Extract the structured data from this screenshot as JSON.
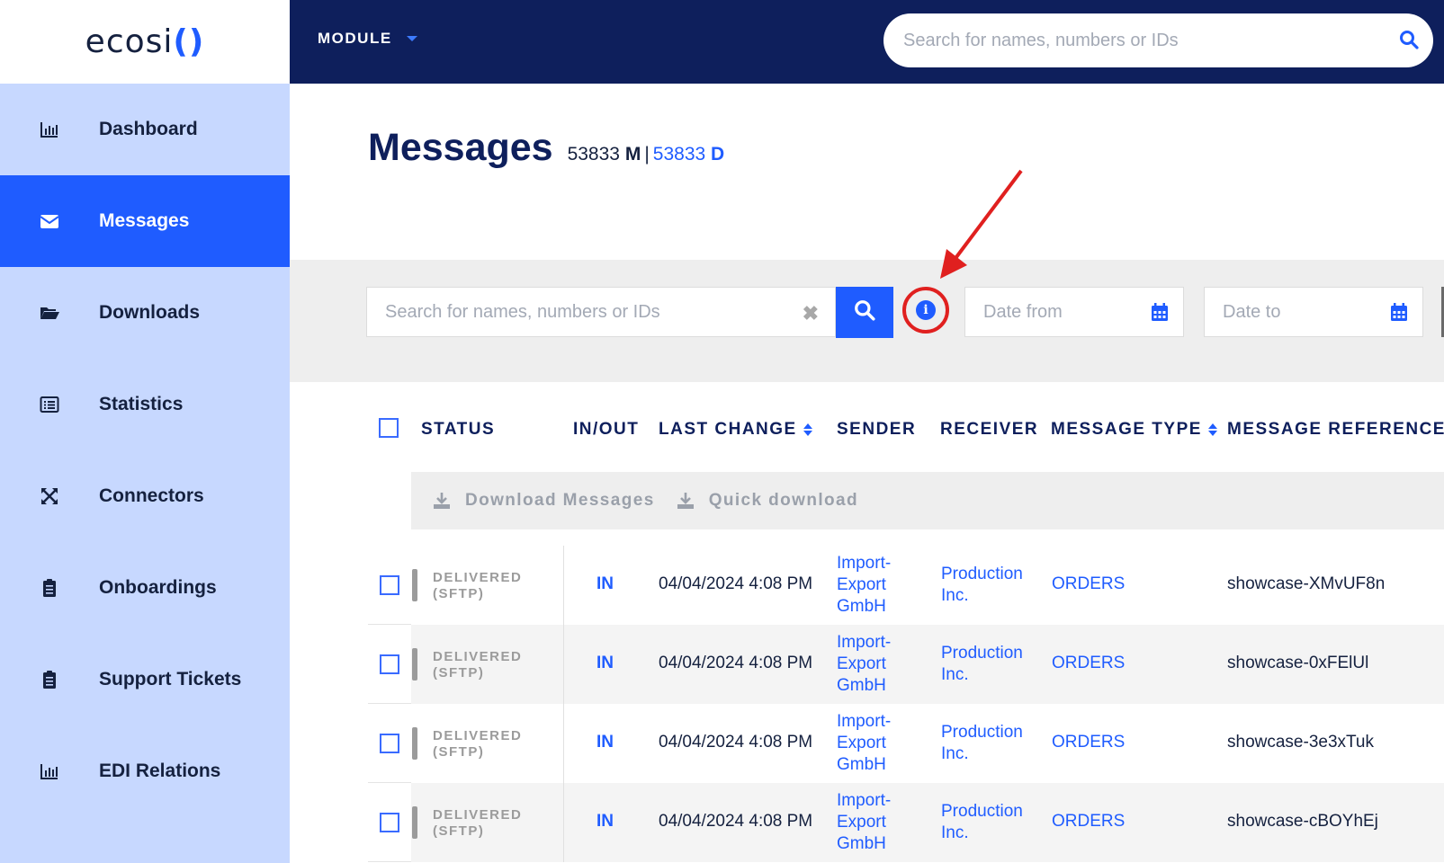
{
  "logo": {
    "text_main": "ecosi",
    "text_accent": "()"
  },
  "sidebar": {
    "items": [
      {
        "label": "Dashboard",
        "icon": "bar-chart-icon",
        "active": false
      },
      {
        "label": "Messages",
        "icon": "envelope-icon",
        "active": true
      },
      {
        "label": "Downloads",
        "icon": "folder-open-icon",
        "active": false
      },
      {
        "label": "Statistics",
        "icon": "list-alt-icon",
        "active": false
      },
      {
        "label": "Connectors",
        "icon": "expand-arrows-icon",
        "active": false
      },
      {
        "label": "Onboardings",
        "icon": "clipboard-icon",
        "active": false
      },
      {
        "label": "Support Tickets",
        "icon": "clipboard-icon",
        "active": false
      },
      {
        "label": "EDI Relations",
        "icon": "bar-chart-icon",
        "active": false
      }
    ]
  },
  "topbar": {
    "module_label": "MODULE",
    "search_placeholder": "Search for names, numbers or IDs"
  },
  "page": {
    "title": "Messages",
    "count_m_value": "53833",
    "count_m_unit": "M",
    "separator": "|",
    "count_d_value": "53833",
    "count_d_unit": "D"
  },
  "filters": {
    "search_placeholder": "Search for names, numbers or IDs",
    "date_from_placeholder": "Date from",
    "date_to_placeholder": "Date to"
  },
  "table": {
    "columns": {
      "status": "STATUS",
      "inout": "IN/OUT",
      "last_change": "LAST CHANGE",
      "sender": "SENDER",
      "receiver": "RECEIVER",
      "message_type": "MESSAGE TYPE",
      "message_reference": "MESSAGE REFERENCE"
    },
    "actions": {
      "download_messages": "Download Messages",
      "quick_download": "Quick download"
    },
    "rows": [
      {
        "status": "DELIVERED\n(SFTP)",
        "inout": "IN",
        "last_change": "04/04/2024 4:08 PM",
        "sender": "Import-\nExport\nGmbH",
        "receiver": "Production\nInc.",
        "message_type": "ORDERS",
        "message_reference": "showcase-XMvUF8n"
      },
      {
        "status": "DELIVERED\n(SFTP)",
        "inout": "IN",
        "last_change": "04/04/2024 4:08 PM",
        "sender": "Import-\nExport\nGmbH",
        "receiver": "Production\nInc.",
        "message_type": "ORDERS",
        "message_reference": "showcase-0xFElUl"
      },
      {
        "status": "DELIVERED\n(SFTP)",
        "inout": "IN",
        "last_change": "04/04/2024 4:08 PM",
        "sender": "Import-\nExport\nGmbH",
        "receiver": "Production\nInc.",
        "message_type": "ORDERS",
        "message_reference": "showcase-3e3xTuk"
      },
      {
        "status": "DELIVERED\n(SFTP)",
        "inout": "IN",
        "last_change": "04/04/2024 4:08 PM",
        "sender": "Import-\nExport\nGmbH",
        "receiver": "Production\nInc.",
        "message_type": "ORDERS",
        "message_reference": "showcase-cBOYhEj"
      }
    ]
  },
  "colors": {
    "brand_blue": "#1f5cff",
    "navy": "#0e1f5c",
    "sidebar_bg": "#c7d8ff",
    "annotation_red": "#e0201f"
  }
}
